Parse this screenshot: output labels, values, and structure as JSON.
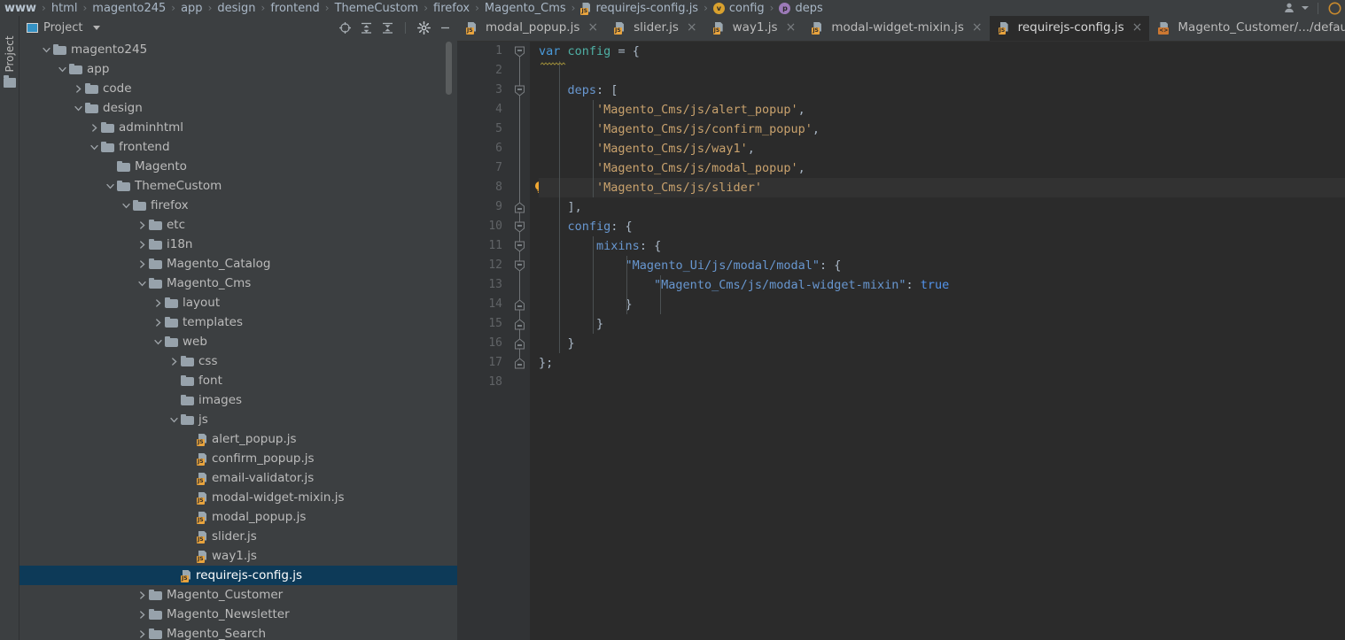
{
  "breadcrumb": [
    {
      "label": "www",
      "icon": null,
      "bold": true
    },
    {
      "label": "html",
      "icon": null,
      "bold": false
    },
    {
      "label": "magento245",
      "icon": null,
      "bold": false
    },
    {
      "label": "app",
      "icon": null,
      "bold": false
    },
    {
      "label": "design",
      "icon": null,
      "bold": false
    },
    {
      "label": "frontend",
      "icon": null,
      "bold": false
    },
    {
      "label": "ThemeCustom",
      "icon": null,
      "bold": false
    },
    {
      "label": "firefox",
      "icon": null,
      "bold": false
    },
    {
      "label": "Magento_Cms",
      "icon": null,
      "bold": false
    },
    {
      "label": "requirejs-config.js",
      "icon": "js-file-icon",
      "bold": false
    },
    {
      "label": "config",
      "icon": "variable-icon",
      "bold": false
    },
    {
      "label": "deps",
      "icon": "property-icon",
      "bold": false
    }
  ],
  "navbar_right": {
    "account_icon": "user-icon",
    "dropdown_icon": "chevron-down-icon",
    "edge_icon": "circle-icon"
  },
  "toolstrip": {
    "project_tab_label": "Project",
    "folder_icon": "folder-icon"
  },
  "panel": {
    "title": "Project",
    "title_icon": "project-swatch-icon",
    "dropdown_icon": "chevron-down-icon",
    "tools": [
      {
        "name": "locate-icon",
        "title": "Select Opened File"
      },
      {
        "name": "expand-all-icon",
        "title": "Expand All"
      },
      {
        "name": "collapse-all-icon",
        "title": "Collapse All"
      },
      {
        "name": "settings-gear-icon",
        "title": "Settings"
      },
      {
        "name": "minimize-icon",
        "title": "Hide"
      }
    ]
  },
  "tree": [
    {
      "label": "magento245",
      "depth": 1,
      "arrow": "down",
      "icon": "folder",
      "selected": false
    },
    {
      "label": "app",
      "depth": 2,
      "arrow": "down",
      "icon": "folder",
      "selected": false
    },
    {
      "label": "code",
      "depth": 3,
      "arrow": "right",
      "icon": "folder",
      "selected": false
    },
    {
      "label": "design",
      "depth": 3,
      "arrow": "down",
      "icon": "folder",
      "selected": false
    },
    {
      "label": "adminhtml",
      "depth": 4,
      "arrow": "right",
      "icon": "folder",
      "selected": false
    },
    {
      "label": "frontend",
      "depth": 4,
      "arrow": "down",
      "icon": "folder",
      "selected": false
    },
    {
      "label": "Magento",
      "depth": 5,
      "arrow": "none",
      "icon": "folder",
      "selected": false
    },
    {
      "label": "ThemeCustom",
      "depth": 5,
      "arrow": "down",
      "icon": "folder",
      "selected": false
    },
    {
      "label": "firefox",
      "depth": 6,
      "arrow": "down",
      "icon": "folder",
      "selected": false
    },
    {
      "label": "etc",
      "depth": 7,
      "arrow": "right",
      "icon": "folder",
      "selected": false
    },
    {
      "label": "i18n",
      "depth": 7,
      "arrow": "right",
      "icon": "folder",
      "selected": false
    },
    {
      "label": "Magento_Catalog",
      "depth": 7,
      "arrow": "right",
      "icon": "folder",
      "selected": false
    },
    {
      "label": "Magento_Cms",
      "depth": 7,
      "arrow": "down",
      "icon": "folder",
      "selected": false
    },
    {
      "label": "layout",
      "depth": 8,
      "arrow": "right",
      "icon": "folder",
      "selected": false
    },
    {
      "label": "templates",
      "depth": 8,
      "arrow": "right",
      "icon": "folder",
      "selected": false
    },
    {
      "label": "web",
      "depth": 8,
      "arrow": "down",
      "icon": "folder",
      "selected": false
    },
    {
      "label": "css",
      "depth": 9,
      "arrow": "right",
      "icon": "folder",
      "selected": false
    },
    {
      "label": "font",
      "depth": 9,
      "arrow": "none",
      "icon": "folder",
      "selected": false
    },
    {
      "label": "images",
      "depth": 9,
      "arrow": "none",
      "icon": "folder",
      "selected": false
    },
    {
      "label": "js",
      "depth": 9,
      "arrow": "down",
      "icon": "folder",
      "selected": false
    },
    {
      "label": "alert_popup.js",
      "depth": 10,
      "arrow": "none",
      "icon": "js",
      "selected": false
    },
    {
      "label": "confirm_popup.js",
      "depth": 10,
      "arrow": "none",
      "icon": "js",
      "selected": false
    },
    {
      "label": "email-validator.js",
      "depth": 10,
      "arrow": "none",
      "icon": "js",
      "selected": false
    },
    {
      "label": "modal-widget-mixin.js",
      "depth": 10,
      "arrow": "none",
      "icon": "js",
      "selected": false
    },
    {
      "label": "modal_popup.js",
      "depth": 10,
      "arrow": "none",
      "icon": "js",
      "selected": false
    },
    {
      "label": "slider.js",
      "depth": 10,
      "arrow": "none",
      "icon": "js",
      "selected": false
    },
    {
      "label": "way1.js",
      "depth": 10,
      "arrow": "none",
      "icon": "js",
      "selected": false
    },
    {
      "label": "requirejs-config.js",
      "depth": 9,
      "arrow": "none",
      "icon": "js",
      "selected": true
    },
    {
      "label": "Magento_Customer",
      "depth": 7,
      "arrow": "right",
      "icon": "folder",
      "selected": false
    },
    {
      "label": "Magento_Newsletter",
      "depth": 7,
      "arrow": "right",
      "icon": "folder",
      "selected": false
    },
    {
      "label": "Magento_Search",
      "depth": 7,
      "arrow": "right",
      "icon": "folder",
      "selected": false
    }
  ],
  "tabs": [
    {
      "label": "modal_popup.js",
      "icon": "js",
      "active": false,
      "closable": true
    },
    {
      "label": "slider.js",
      "icon": "js",
      "active": false,
      "closable": true
    },
    {
      "label": "way1.js",
      "icon": "js",
      "active": false,
      "closable": true
    },
    {
      "label": "modal-widget-mixin.js",
      "icon": "js",
      "active": false,
      "closable": true
    },
    {
      "label": "requirejs-config.js",
      "icon": "js",
      "active": true,
      "closable": true
    },
    {
      "label": "Magento_Customer/.../default.xml",
      "icon": "xml",
      "active": false,
      "closable": false
    }
  ],
  "editor": {
    "current_line": 8,
    "line_count": 18,
    "bulb_line": 8,
    "bulb_icon": "lightbulb-icon",
    "line_numbers": [
      1,
      2,
      3,
      4,
      5,
      6,
      7,
      8,
      9,
      10,
      11,
      12,
      13,
      14,
      15,
      16,
      17,
      18
    ],
    "code_lines": [
      {
        "n": 1,
        "tokens": [
          {
            "t": "var",
            "c": "kw"
          },
          {
            "t": " ",
            "c": "punct"
          },
          {
            "t": "config",
            "c": "id-green"
          },
          {
            "t": " = {",
            "c": "punct"
          }
        ]
      },
      {
        "n": 2,
        "tokens": []
      },
      {
        "n": 3,
        "tokens": [
          {
            "t": "    ",
            "c": "punct"
          },
          {
            "t": "deps",
            "c": "prop"
          },
          {
            "t": ": [",
            "c": "punct"
          }
        ]
      },
      {
        "n": 4,
        "tokens": [
          {
            "t": "        ",
            "c": "punct"
          },
          {
            "t": "'Magento_Cms/js/alert_popup'",
            "c": "str"
          },
          {
            "t": ",",
            "c": "punct"
          }
        ]
      },
      {
        "n": 5,
        "tokens": [
          {
            "t": "        ",
            "c": "punct"
          },
          {
            "t": "'Magento_Cms/js/confirm_popup'",
            "c": "str"
          },
          {
            "t": ",",
            "c": "punct"
          }
        ]
      },
      {
        "n": 6,
        "tokens": [
          {
            "t": "        ",
            "c": "punct"
          },
          {
            "t": "'Magento_Cms/js/way1'",
            "c": "str"
          },
          {
            "t": ",",
            "c": "punct"
          }
        ]
      },
      {
        "n": 7,
        "tokens": [
          {
            "t": "        ",
            "c": "punct"
          },
          {
            "t": "'Magento_Cms/js/modal_popup'",
            "c": "str"
          },
          {
            "t": ",",
            "c": "punct"
          }
        ]
      },
      {
        "n": 8,
        "tokens": [
          {
            "t": "        ",
            "c": "punct"
          },
          {
            "t": "'Magento_Cms/js/slider'",
            "c": "str"
          }
        ]
      },
      {
        "n": 9,
        "tokens": [
          {
            "t": "    ],",
            "c": "punct"
          }
        ]
      },
      {
        "n": 10,
        "tokens": [
          {
            "t": "    ",
            "c": "punct"
          },
          {
            "t": "config",
            "c": "prop"
          },
          {
            "t": ": {",
            "c": "punct"
          }
        ]
      },
      {
        "n": 11,
        "tokens": [
          {
            "t": "        ",
            "c": "punct"
          },
          {
            "t": "mixins",
            "c": "prop"
          },
          {
            "t": ": {",
            "c": "punct"
          }
        ]
      },
      {
        "n": 12,
        "tokens": [
          {
            "t": "            ",
            "c": "punct"
          },
          {
            "t": "\"Magento_Ui/js/modal/modal\"",
            "c": "prop"
          },
          {
            "t": ": {",
            "c": "punct"
          }
        ]
      },
      {
        "n": 13,
        "tokens": [
          {
            "t": "                ",
            "c": "punct"
          },
          {
            "t": "\"Magento_Cms/js/modal-widget-mixin\"",
            "c": "prop"
          },
          {
            "t": ": ",
            "c": "punct"
          },
          {
            "t": "true",
            "c": "bool"
          }
        ]
      },
      {
        "n": 14,
        "tokens": [
          {
            "t": "            }",
            "c": "punct"
          }
        ]
      },
      {
        "n": 15,
        "tokens": [
          {
            "t": "        }",
            "c": "punct"
          }
        ]
      },
      {
        "n": 16,
        "tokens": [
          {
            "t": "    }",
            "c": "punct"
          }
        ]
      },
      {
        "n": 17,
        "tokens": [
          {
            "t": "};",
            "c": "punct"
          }
        ]
      },
      {
        "n": 18,
        "tokens": []
      }
    ],
    "fold_markers": [
      {
        "line": 1,
        "state": "open"
      },
      {
        "line": 3,
        "state": "open"
      },
      {
        "line": 9,
        "state": "close"
      },
      {
        "line": 10,
        "state": "open"
      },
      {
        "line": 11,
        "state": "open"
      },
      {
        "line": 12,
        "state": "open"
      },
      {
        "line": 14,
        "state": "close"
      },
      {
        "line": 15,
        "state": "close"
      },
      {
        "line": 16,
        "state": "close"
      },
      {
        "line": 17,
        "state": "close"
      }
    ]
  },
  "colors": {
    "background": "#2b2b2b",
    "chrome": "#3c3f41",
    "gutter": "#313335",
    "selection": "#0d3a58",
    "keyword": "#4a9ada",
    "string": "#c9a26d",
    "property": "#6897d0",
    "identifier": "#4fb0a5",
    "text": "#a9b7c6",
    "accent_js": "#e8a33d"
  }
}
